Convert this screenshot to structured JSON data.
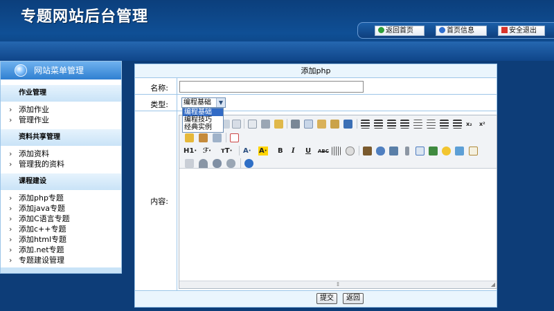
{
  "header": {
    "title": "专题网站后台管理",
    "nav": [
      {
        "label": "返回首页",
        "icon": "home-return-icon",
        "color": "#2e9e3a"
      },
      {
        "label": "首页信息",
        "icon": "info-icon",
        "color": "#2f6fd0"
      },
      {
        "label": "安全退出",
        "icon": "exit-icon",
        "color": "#d8342b"
      }
    ]
  },
  "sidebar": {
    "title": "网站菜单管理",
    "sections": [
      {
        "title": "作业管理",
        "items": [
          "添加作业",
          "管理作业"
        ]
      },
      {
        "title": "资料共享管理",
        "items": [
          "添加资料",
          "管理我的资料"
        ]
      },
      {
        "title": "课程建设",
        "items": [
          "添加php专题",
          "添加java专题",
          "添加C语言专题",
          "添加c++专题",
          "添加html专题",
          "添加.net专题",
          "专题建设管理"
        ]
      }
    ]
  },
  "form": {
    "title": "添加php",
    "name_label": "名称:",
    "name_value": "",
    "type_label": "类型:",
    "type_selected": "编程基础",
    "type_options": [
      "编程基础",
      "编程技巧",
      "经典实例"
    ],
    "content_label": "内容:",
    "toolbar_text": {
      "heading": "H1·",
      "font": "ℱ·",
      "size": "тT·",
      "fontcolor": "A·",
      "bgcolor": "A·",
      "bold": "B",
      "italic": "I",
      "underline": "U",
      "strike": "ABC",
      "sub": "x₂",
      "sup": "x²"
    },
    "submit_label": "提交",
    "back_label": "返回"
  }
}
